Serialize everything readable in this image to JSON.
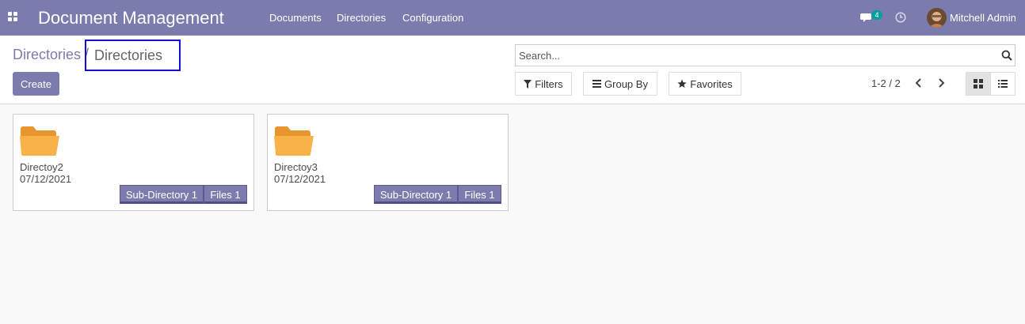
{
  "navbar": {
    "app_title": "Document Management",
    "menu": [
      "Documents",
      "Directories",
      "Configuration"
    ],
    "chat_count": "4",
    "user_name": "Mitchell Admin",
    "colors": {
      "primary": "#7c7bad",
      "badge": "#00a09d"
    }
  },
  "breadcrumb": {
    "parent": "Directories",
    "separator": "/",
    "current": "Directories"
  },
  "actions": {
    "create_label": "Create"
  },
  "search": {
    "placeholder": "Search...",
    "value": ""
  },
  "filters": {
    "filters_label": "Filters",
    "group_by_label": "Group By",
    "favorites_label": "Favorites"
  },
  "pager": {
    "value": "1-2 / 2"
  },
  "view_switcher": {
    "active": "kanban",
    "icons": [
      "kanban-icon",
      "list-icon"
    ]
  },
  "cards": [
    {
      "name": "Directoy2",
      "date": "07/12/2021",
      "sub_directory": "Sub-Directory 1",
      "files": "Files 1"
    },
    {
      "name": "Directoy3",
      "date": "07/12/2021",
      "sub_directory": "Sub-Directory 1",
      "files": "Files 1"
    }
  ],
  "icons": {
    "apps": "apps-grid-icon",
    "chat": "chat-icon",
    "activity": "clock-icon",
    "search": "search-icon",
    "filter": "filter-icon",
    "group": "bars-icon",
    "favorite": "star-icon",
    "prev": "chevron-left-icon",
    "next": "chevron-right-icon",
    "folder": "folder-icon"
  },
  "folder_color": "#f5a63d"
}
